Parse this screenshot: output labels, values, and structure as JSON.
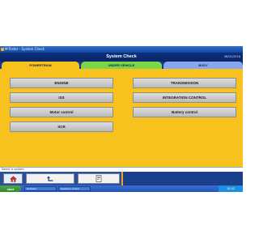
{
  "window": {
    "title": "M-Tester - System Check"
  },
  "header": {
    "title": "System Check",
    "meta": "06/01/2016"
  },
  "tabs": [
    {
      "label": "POWERTRAIN",
      "state": "active"
    },
    {
      "label": "UNDER VEHICLE"
    },
    {
      "label": "BODY"
    }
  ],
  "systems_left": [
    "ENGINE",
    "ISS",
    "Motor control",
    "SCR"
  ],
  "systems_right": [
    "TRANSMISSION",
    "INTEGRATION CONTROL",
    "Battery control"
  ],
  "statusbar": {
    "text": "Select a system"
  },
  "toolbar": {
    "icons": [
      "home-icon",
      "back-arrow-icon",
      "print-icon"
    ]
  },
  "taskbar": {
    "start_label": "start",
    "items": [
      "M-Tester",
      "Systems Check"
    ],
    "clock": "10:42"
  },
  "colors": {
    "powertrain_tab": "#f7c21d",
    "under_vehicle_tab": "#7bd64a",
    "body_tab": "#88a7f2",
    "header": "#0b2f7c",
    "toolbar_accent": "#f4a21a"
  }
}
